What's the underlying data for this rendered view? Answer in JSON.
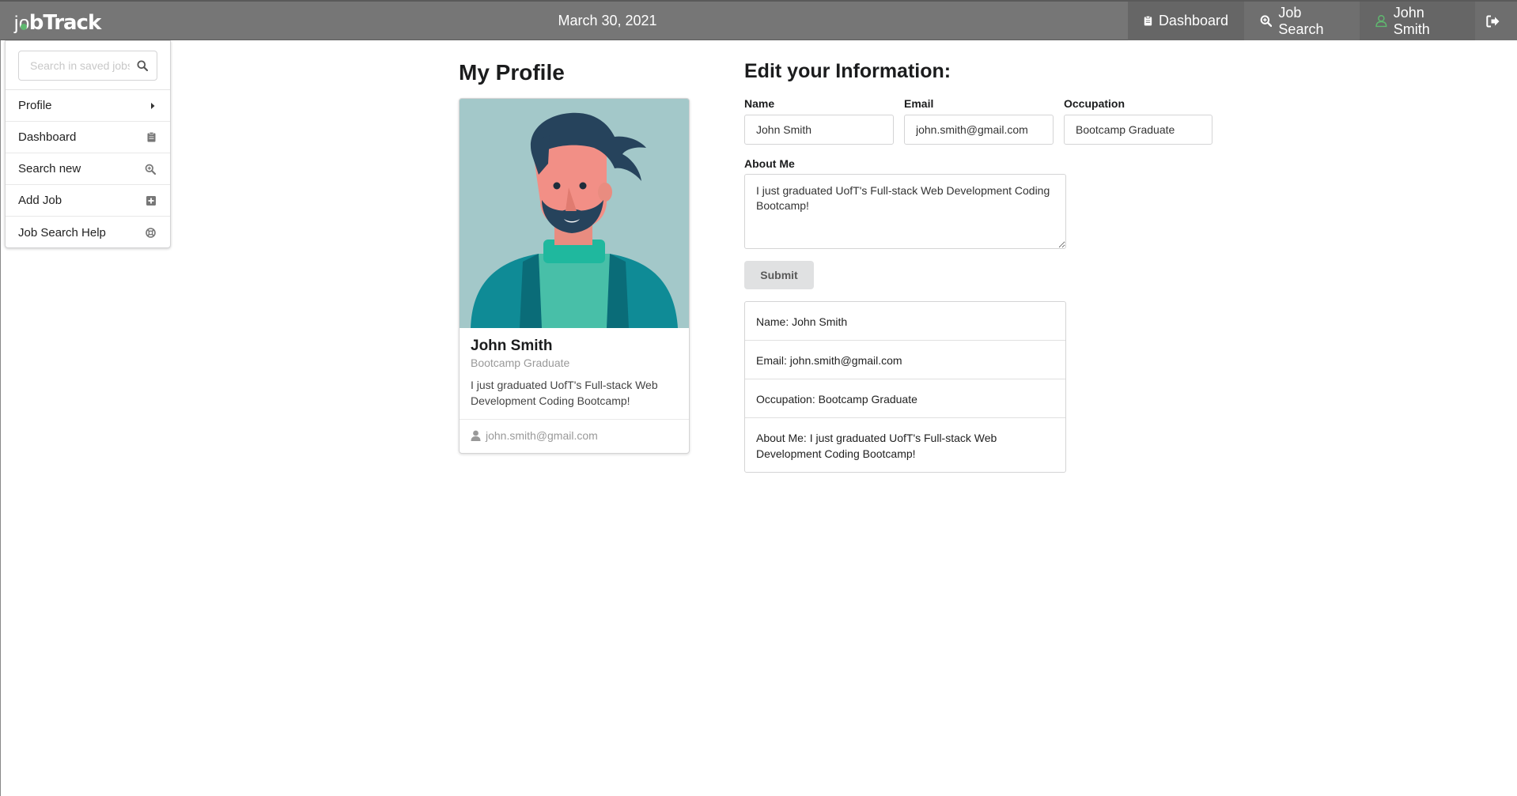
{
  "header": {
    "logo_j": "j",
    "logo_o": "o",
    "logo_rest": "bTrack",
    "date": "March 30, 2021",
    "nav": {
      "dashboard": "Dashboard",
      "job_search": "Job Search",
      "user": "John Smith"
    },
    "icons": {
      "dashboard": "clipboard-icon",
      "job_search": "search-zoom-icon",
      "user": "user-icon",
      "logout": "sign-out-icon"
    },
    "colors": {
      "bar": "#767676",
      "user_icon": "#5fb86f"
    }
  },
  "sidebar": {
    "search_placeholder": "Search in saved jobs",
    "items": [
      {
        "label": "Profile",
        "icon": "caret-right-icon"
      },
      {
        "label": "Dashboard",
        "icon": "clipboard-icon"
      },
      {
        "label": "Search new",
        "icon": "zoom-in-icon"
      },
      {
        "label": "Add Job",
        "icon": "plus-square-icon"
      },
      {
        "label": "Job Search Help",
        "icon": "life-ring-icon"
      }
    ]
  },
  "profile": {
    "title": "My Profile",
    "name": "John Smith",
    "occupation": "Bootcamp Graduate",
    "about": "I just graduated UofT's Full-stack Web Development Coding Bootcamp!",
    "email": "john.smith@gmail.com"
  },
  "edit": {
    "title": "Edit your Information:",
    "labels": {
      "name": "Name",
      "email": "Email",
      "occupation": "Occupation",
      "about": "About Me"
    },
    "values": {
      "name": "John Smith",
      "email": "john.smith@gmail.com",
      "occupation": "Bootcamp Graduate",
      "about": "I just graduated UofT's Full-stack Web Development Coding Bootcamp!"
    },
    "submit": "Submit"
  },
  "summary": {
    "name": "Name: John Smith",
    "email": "Email: john.smith@gmail.com",
    "occupation": "Occupation: Bootcamp Graduate",
    "about": "About Me: I just graduated UofT's Full-stack Web Development Coding Bootcamp!"
  }
}
